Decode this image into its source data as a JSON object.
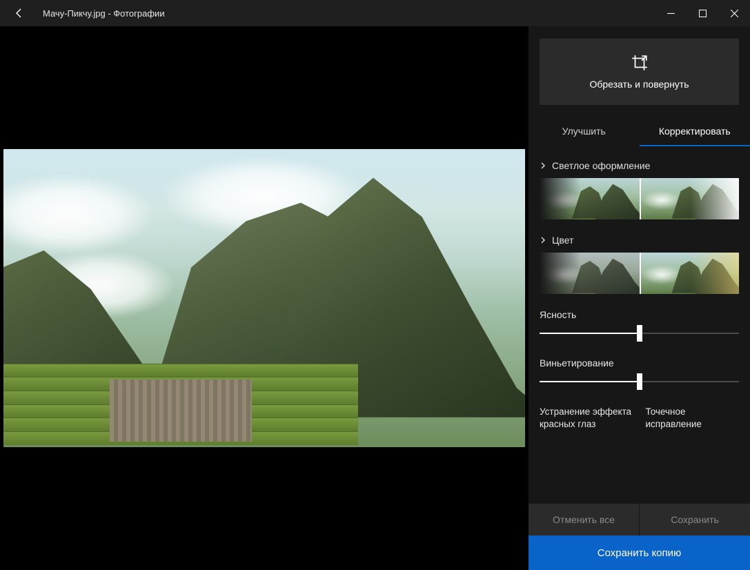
{
  "titlebar": {
    "title": "Мачу-Пикчу.jpg - Фотографии"
  },
  "panel": {
    "crop_rotate_label": "Обрезать и повернуть",
    "tabs": {
      "enhance": "Улучшить",
      "adjust": "Корректировать"
    },
    "sections": {
      "light": "Светлое оформление",
      "color": "Цвет"
    },
    "sliders": {
      "clarity": {
        "label": "Ясность",
        "value_pct": 50
      },
      "vignette": {
        "label": "Виньетирование",
        "value_pct": 50
      }
    },
    "tools": {
      "red_eye": "Устранение эффекта красных глаз",
      "spot_fix": "Точечное исправление"
    }
  },
  "footer": {
    "undo_all": "Отменить все",
    "save": "Сохранить",
    "save_copy": "Сохранить копию"
  }
}
